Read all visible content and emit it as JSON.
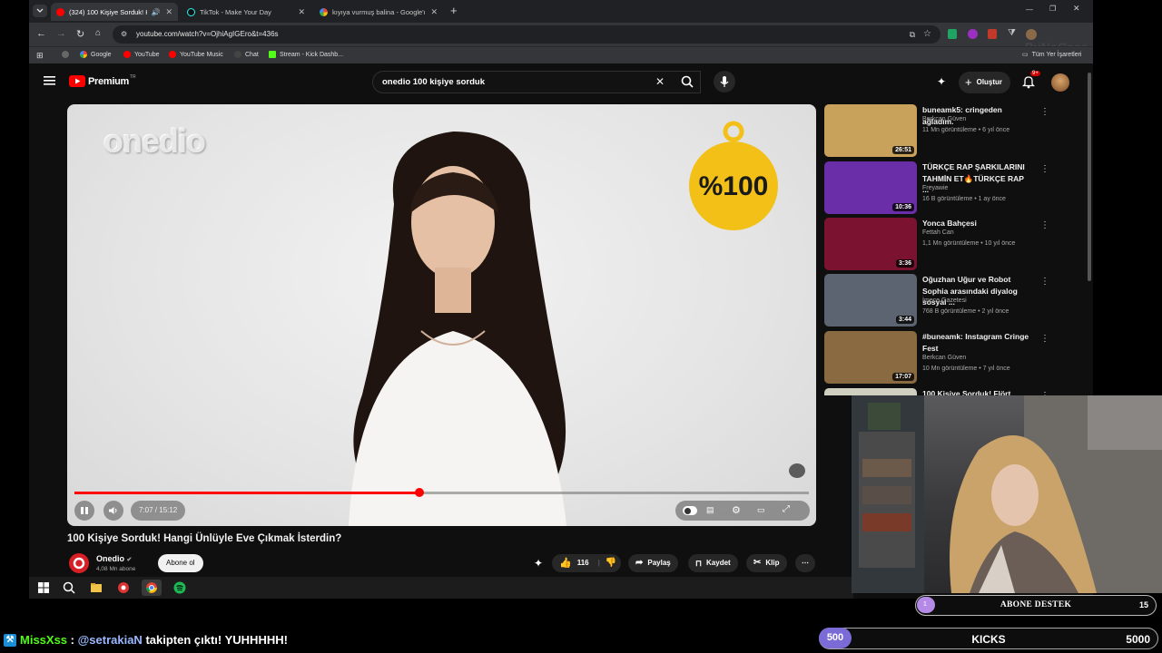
{
  "browser": {
    "tabs": [
      {
        "label": "(324) 100 Kişiye Sorduk! Ha",
        "active": true
      },
      {
        "label": "TikTok - Make Your Day",
        "active": false
      },
      {
        "label": "kıyıya vurmuş balina - Google'd",
        "active": false
      }
    ],
    "url": "youtube.com/watch?v=OjhiAgIGEro&t=436s",
    "bookmarks": [
      "Google",
      "YouTube",
      "YouTube Music",
      "Chat",
      "Stream - Kick Dashb...",
      "Tüm Yer İşaretleri"
    ],
    "watermark": "ByNoCase"
  },
  "youtube": {
    "logo_text": "Premium",
    "logo_sup": "TR",
    "search_value": "onedio 100 kişiye sorduk",
    "create_label": "Oluştur",
    "notif_badge": "9+"
  },
  "player": {
    "watermark": "onedio",
    "badge_text": "%100",
    "time": "7:07 / 15:12",
    "progress": 0.47
  },
  "video": {
    "title": "100 Kişiye Sorduk! Hangi Ünlüyle Eve Çıkmak İsterdin?",
    "channel": "Onedio",
    "subs": "4,08 Mn abone",
    "subscribe_label": "Abone ol",
    "likes": "116",
    "share_label": "Paylaş",
    "save_label": "Kaydet",
    "clip_label": "Klip"
  },
  "sidebar": [
    {
      "title": "buneamk5: cringeden ağladım.",
      "channel": "Berkcan Güven",
      "meta": "11 Mn görüntüleme • 6 yıl önce",
      "duration": "26:51",
      "color": "#c8a15a"
    },
    {
      "title": "TÜRKÇE RAP ŞARKILARINI TAHMİN ET🔥TÜRKÇE RAP ...",
      "channel": "Freyawie",
      "meta": "16 B görüntüleme • 1 ay önce",
      "duration": "10:36",
      "color": "#6a2ea8"
    },
    {
      "title": "Yonca Bahçesi",
      "channel": "Fettah Can",
      "meta": "1,1 Mn görüntüleme • 10 yıl önce",
      "duration": "3:36",
      "color": "#7a1230"
    },
    {
      "title": "Oğuzhan Uğur ve Robot Sophia arasındaki diyalog sosyal ...",
      "channel": "İmece Gazetesi",
      "meta": "768 B görüntüleme • 2 yıl önce",
      "duration": "3:44",
      "color": "#5b6470"
    },
    {
      "title": "#buneamk: Instagram Cringe Fest",
      "channel": "Berkcan Güven",
      "meta": "10 Mn görüntüleme • 7 yıl önce",
      "duration": "17:07",
      "color": "#8a6a40"
    },
    {
      "title": "100 Kişiye Sorduk! Flört",
      "channel": "",
      "meta": "",
      "duration": "",
      "color": "#d0d0c0"
    }
  ],
  "taskbar": [
    "windows-start",
    "search",
    "file-explorer",
    "chrome-record",
    "chrome",
    "spotify"
  ],
  "overlay": {
    "goal_label": "ABONE DESTEK",
    "goal_count": "15",
    "goal_start": "1",
    "chat_user": "MissXss",
    "chat_sep": " : ",
    "chat_mention": "@setrakiaN",
    "chat_msg": " takipten çıktı! YUHHHHH!",
    "kicks_left": "500",
    "kicks_label": "KICKS",
    "kicks_right": "5000"
  },
  "colors": {
    "youtube_red": "#ff0000",
    "kick_green": "#53fc18",
    "goal_purple": "#b48ae6",
    "kicks_purple": "#7b6bd6",
    "chat_user": "#53fc18",
    "chat_mention": "#9ab8ff"
  }
}
